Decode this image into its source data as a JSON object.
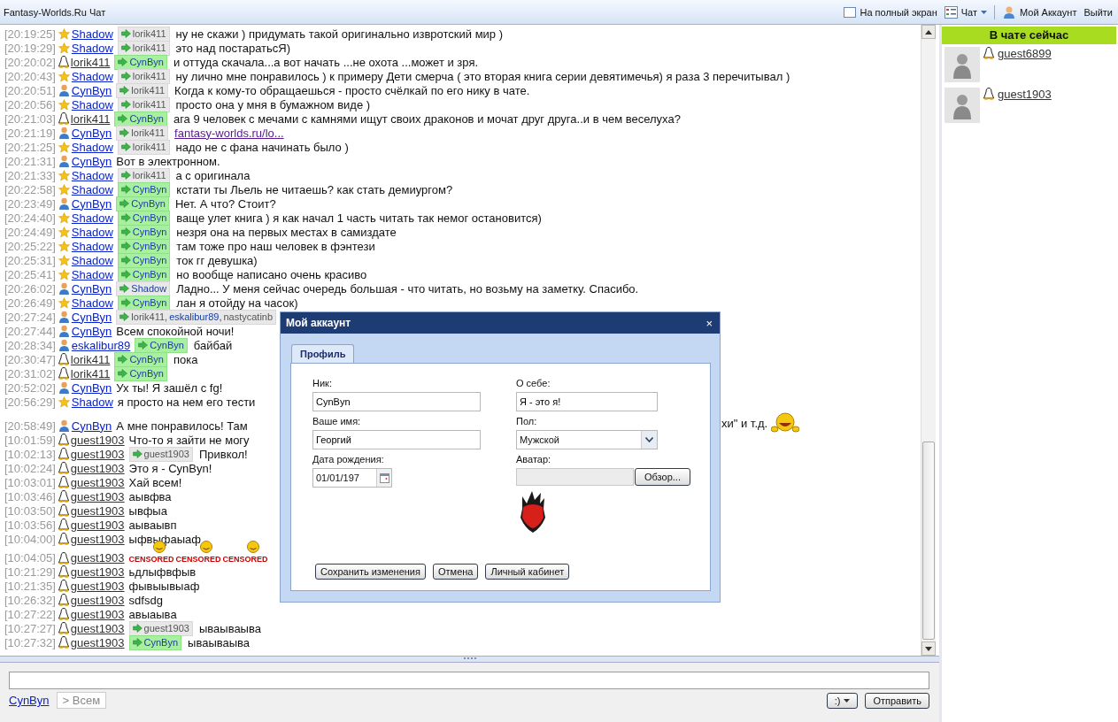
{
  "app_title": "Fantasy-Worlds.Ru Чат",
  "toolbar": [
    {
      "kind": "fullscreen",
      "label": "На полный экран"
    },
    {
      "kind": "chat",
      "label": "Чат"
    },
    {
      "kind": "account",
      "label": "Мой Аккаунт"
    },
    {
      "kind": "logout",
      "label": "Выйти"
    }
  ],
  "messages": [
    {
      "time": "[20:19:25]",
      "kind": "star",
      "author": "Shadow",
      "to": {
        "highlighted": false,
        "names": [
          {
            "name": "lorik411",
            "color": "#555555"
          }
        ]
      },
      "text": "ну не скажи ) придумать такой оригинально извротский мир )"
    },
    {
      "time": "[20:19:29]",
      "kind": "star",
      "author": "Shadow",
      "to": {
        "highlighted": false,
        "names": [
          {
            "name": "lorik411",
            "color": "#555555"
          }
        ]
      },
      "text": "это над постаратьсЯ)"
    },
    {
      "time": "[20:20:02]",
      "kind": "tux",
      "author": "lorik411",
      "to": {
        "highlighted": true,
        "names": [
          {
            "name": "CynByn",
            "color": "#1a3ca0"
          }
        ]
      },
      "text": "и оттуда скачала...а вот начать ...не охота ...может и зря."
    },
    {
      "time": "[20:20:43]",
      "kind": "star",
      "author": "Shadow",
      "to": {
        "highlighted": false,
        "names": [
          {
            "name": "lorik411",
            "color": "#555555"
          }
        ]
      },
      "text": "ну лично мне понравилось ) к примеру Дети смерча ( это вторая книга серии девятимечья) я раза 3 перечитывал )"
    },
    {
      "time": "[20:20:51]",
      "kind": "user",
      "author": "CynByn",
      "to": {
        "highlighted": false,
        "names": [
          {
            "name": "lorik411",
            "color": "#555555"
          }
        ]
      },
      "text": "Когда к кому-то обращаешься - просто счёлкай по его нику в чате."
    },
    {
      "time": "[20:20:56]",
      "kind": "star",
      "author": "Shadow",
      "to": {
        "highlighted": false,
        "names": [
          {
            "name": "lorik411",
            "color": "#555555"
          }
        ]
      },
      "text": "просто она у мня в бумажном виде )"
    },
    {
      "time": "[20:21:03]",
      "kind": "tux",
      "author": "lorik411",
      "to": {
        "highlighted": true,
        "names": [
          {
            "name": "CynByn",
            "color": "#1a3ca0"
          }
        ]
      },
      "text": "ага 9 человек с мечами с камнями ищут своих драконов и мочат друг друга..и в чем веселуха?"
    },
    {
      "time": "[20:21:19]",
      "kind": "user",
      "author": "CynByn",
      "to": {
        "highlighted": false,
        "names": [
          {
            "name": "lorik411",
            "color": "#555555"
          }
        ]
      },
      "link": "fantasy-worlds.ru/lo..."
    },
    {
      "time": "[20:21:25]",
      "kind": "star",
      "author": "Shadow",
      "to": {
        "highlighted": false,
        "names": [
          {
            "name": "lorik411",
            "color": "#555555"
          }
        ]
      },
      "text": "надо не с фана начинать было )"
    },
    {
      "time": "[20:21:31]",
      "kind": "user",
      "author": "CynByn",
      "text": "Вот в электронном."
    },
    {
      "time": "[20:21:33]",
      "kind": "star",
      "author": "Shadow",
      "to": {
        "highlighted": false,
        "names": [
          {
            "name": "lorik411",
            "color": "#555555"
          }
        ]
      },
      "text": "а с оригинала"
    },
    {
      "time": "[20:22:58]",
      "kind": "star",
      "author": "Shadow",
      "to": {
        "highlighted": true,
        "names": [
          {
            "name": "CynByn",
            "color": "#1a3ca0"
          }
        ]
      },
      "text": "кстати ты Льель не читаешь? как стать демиургом?"
    },
    {
      "time": "[20:23:49]",
      "kind": "user",
      "author": "CynByn",
      "to": {
        "highlighted": true,
        "names": [
          {
            "name": "CynByn",
            "color": "#1a3ca0"
          }
        ]
      },
      "text": "Нет. А что? Стоит?"
    },
    {
      "time": "[20:24:40]",
      "kind": "star",
      "author": "Shadow",
      "to": {
        "highlighted": true,
        "names": [
          {
            "name": "CynByn",
            "color": "#1a3ca0"
          }
        ]
      },
      "text": "ваще улет книга ) я как начал 1 часть читать так немог остановится)"
    },
    {
      "time": "[20:24:49]",
      "kind": "star",
      "author": "Shadow",
      "to": {
        "highlighted": true,
        "names": [
          {
            "name": "CynByn",
            "color": "#1a3ca0"
          }
        ]
      },
      "text": "незря она на первых местах в самиздате"
    },
    {
      "time": "[20:25:22]",
      "kind": "star",
      "author": "Shadow",
      "to": {
        "highlighted": true,
        "names": [
          {
            "name": "CynByn",
            "color": "#1a3ca0"
          }
        ]
      },
      "text": "там тоже про наш человек в фэнтези"
    },
    {
      "time": "[20:25:31]",
      "kind": "star",
      "author": "Shadow",
      "to": {
        "highlighted": true,
        "names": [
          {
            "name": "CynByn",
            "color": "#1a3ca0"
          }
        ]
      },
      "text": "ток гг девушка)"
    },
    {
      "time": "[20:25:41]",
      "kind": "star",
      "author": "Shadow",
      "to": {
        "highlighted": true,
        "names": [
          {
            "name": "CynByn",
            "color": "#1a3ca0"
          }
        ]
      },
      "text": "но вообще написано очень красиво"
    },
    {
      "time": "[20:26:02]",
      "kind": "user",
      "author": "CynByn",
      "to": {
        "highlighted": false,
        "names": [
          {
            "name": "Shadow",
            "color": "#1a3ca0"
          }
        ]
      },
      "text": "Ладно... У меня сейчас очередь большая - что читать, но возьму на заметку. Спасибо."
    },
    {
      "time": "[20:26:49]",
      "kind": "star",
      "author": "Shadow",
      "to": {
        "highlighted": true,
        "names": [
          {
            "name": "CynByn",
            "color": "#1a3ca0"
          }
        ]
      },
      "text": "лан я отойду на часок)"
    },
    {
      "time": "[20:27:24]",
      "kind": "user",
      "author": "CynByn",
      "to": {
        "highlighted": false,
        "names": [
          {
            "name": "lorik411,",
            "color": "#555555"
          },
          {
            "name": "eskalibur89,",
            "color": "#1a3ca0"
          },
          {
            "name": "nastycatinb",
            "color": "#555555"
          }
        ]
      }
    },
    {
      "time": "[20:27:44]",
      "kind": "user",
      "author": "CynByn",
      "text": "Всем спокойной ночи!"
    },
    {
      "time": "[20:28:34]",
      "kind": "user",
      "author": "eskalibur89",
      "to": {
        "highlighted": true,
        "names": [
          {
            "name": "CynByn",
            "color": "#1a3ca0"
          }
        ]
      },
      "text": "байбай"
    },
    {
      "time": "[20:30:47]",
      "kind": "tux",
      "author": "lorik411",
      "to": {
        "highlighted": true,
        "names": [
          {
            "name": "CynByn",
            "color": "#1a3ca0"
          }
        ]
      },
      "text": "пока"
    },
    {
      "time": "[20:31:02]",
      "kind": "tux",
      "author": "lorik411",
      "to": {
        "highlighted": true,
        "names": [
          {
            "name": "CynByn",
            "color": "#1a3ca0"
          }
        ]
      }
    },
    {
      "time": "[20:52:02]",
      "kind": "user",
      "author": "CynByn",
      "text": "Ух ты! Я зашёл с fg!"
    },
    {
      "time": "[20:56:29]",
      "kind": "star",
      "author": "Shadow",
      "text": "я просто на нем его тести"
    },
    {
      "time": "[20:58:49]",
      "kind": "user",
      "author": "CynByn",
      "gap_before": true,
      "text": "А мне понравилось! Там",
      "tail": "хи\" и т.д."
    },
    {
      "time": "[10:01:59]",
      "kind": "tux",
      "author": "guest1903",
      "text": "Что-то я зайти не могу"
    },
    {
      "time": "[10:02:13]",
      "kind": "tux",
      "author": "guest1903",
      "to": {
        "highlighted": false,
        "names": [
          {
            "name": "guest1903",
            "color": "#555555"
          }
        ]
      },
      "text": "Привкол!"
    },
    {
      "time": "[10:02:24]",
      "kind": "tux",
      "author": "guest1903",
      "text": "Это я - CynByn!"
    },
    {
      "time": "[10:03:01]",
      "kind": "tux",
      "author": "guest1903",
      "text": "Хай всем!"
    },
    {
      "time": "[10:03:46]",
      "kind": "tux",
      "author": "guest1903",
      "text": "аывфва"
    },
    {
      "time": "[10:03:50]",
      "kind": "tux",
      "author": "guest1903",
      "text": "ывфыа"
    },
    {
      "time": "[10:03:56]",
      "kind": "tux",
      "author": "guest1903",
      "text": "аываывп"
    },
    {
      "time": "[10:04:00]",
      "kind": "tux",
      "author": "guest1903",
      "text": "ыфвыфаыаф"
    },
    {
      "time": "[10:04:05]",
      "kind": "tux",
      "author": "guest1903",
      "censored": [
        "CENSORED",
        "CENSORED",
        "CENSORED"
      ]
    },
    {
      "time": "[10:21:29]",
      "kind": "tux",
      "author": "guest1903",
      "text": "ьдлыфвфыв"
    },
    {
      "time": "[10:21:35]",
      "kind": "tux",
      "author": "guest1903",
      "text": "фывыывыаф"
    },
    {
      "time": "[10:26:32]",
      "kind": "tux",
      "author": "guest1903",
      "text": "sdfsdg"
    },
    {
      "time": "[10:27:22]",
      "kind": "tux",
      "author": "guest1903",
      "text": "авыаыва"
    },
    {
      "time": "[10:27:27]",
      "kind": "tux",
      "author": "guest1903",
      "to": {
        "highlighted": false,
        "names": [
          {
            "name": "guest1903",
            "color": "#555555"
          }
        ]
      },
      "text": "ываываыва"
    },
    {
      "time": "[10:27:32]",
      "kind": "tux",
      "author": "guest1903",
      "to": {
        "highlighted": true,
        "names": [
          {
            "name": "CynByn",
            "color": "#1a3ca0"
          }
        ]
      },
      "text": "ываываыва"
    }
  ],
  "composer": {
    "user": "CynByn",
    "recipient": "> Всем",
    "smiley_button": ":)",
    "send_button": "Отправить"
  },
  "online": {
    "title": "В чате сейчас",
    "users": [
      {
        "name": "guest6899"
      },
      {
        "name": "guest1903"
      }
    ]
  },
  "dialog": {
    "title": "Мой аккаунт",
    "close": "×",
    "tabs": [
      {
        "label": "Профиль",
        "selected": true
      }
    ],
    "fields": [
      {
        "kind": "text",
        "label": "Ник:",
        "value": "CynByn"
      },
      {
        "kind": "text",
        "label": "О себе:",
        "value": "Я - это я!"
      },
      {
        "kind": "text",
        "label": "Ваше имя:",
        "value": "Георгий"
      },
      {
        "kind": "select",
        "label": "Пол:",
        "value": "Мужской"
      },
      {
        "kind": "date",
        "label": "Дата рождения:",
        "value": "01/01/197"
      },
      {
        "kind": "file",
        "label": "Аватар:",
        "button": "Обзор..."
      }
    ],
    "buttons": [
      "Сохранить изменения",
      "Отмена",
      "Личный кабинет"
    ]
  }
}
